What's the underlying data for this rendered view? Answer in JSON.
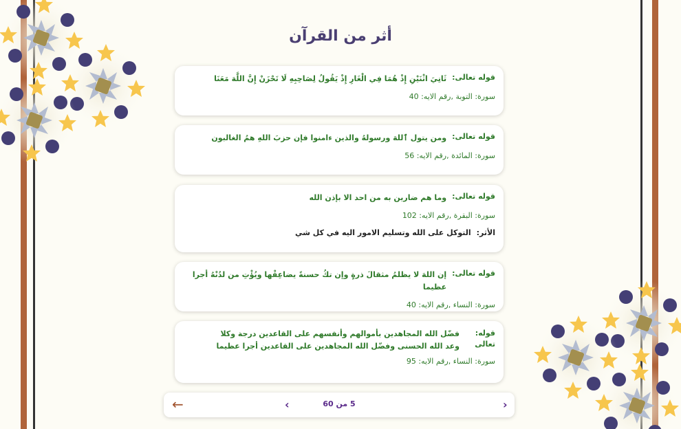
{
  "page": {
    "title": "أثر من القرآن"
  },
  "cards": [
    {
      "label": "قوله تعالى:",
      "verse": "ثَانِيَ اثْنَيْنِ إِذْ هُمَا فِي الْغَارِ إِذْ يَقُولُ لِصَاحِبِهِ لَا تَحْزَنْ إِنَّ اللَّهَ مَعَنَا",
      "reference": "سورة: التوبة ,رقم الايه: 40"
    },
    {
      "label": "قوله تعالى:",
      "verse": "ومن يتول ٱللهَ ورسولهُ والذين ءامنوا فإن حزبَ اللهِ همُ الغالبون",
      "reference": "سورة: المائدة ,رقم الايه: 56"
    },
    {
      "label": "قوله تعالى:",
      "verse": "وما هم ضارين به من احد الا بإذن الله",
      "reference": "سورة: البقرة ,رقم الايه: 102",
      "effect_label": "الأثر:",
      "effect": "التوكل على الله وتسليم الامور اليه في كل شي"
    },
    {
      "label": "قوله تعالى:",
      "verse": "إن اللهَ لا يظلمُ مثقالَ ذرةٍ وإن تكُ حسنةً يضاعِفْها ويُؤْتِ من لدُنْهُ أجرا عظيما",
      "reference": "سورة: النساء ,رقم الايه: 40"
    },
    {
      "label": "قوله: تعالى",
      "verse": "فضّل الله المجاهدين بأموالهم وأنفسهم على القاعدين درجة وكلا وعد الله الحسنى وفضّل الله المجاهدين على القاعدين أجرا عظيما",
      "reference": "سورة: النساء ,رقم الايه: 95"
    }
  ],
  "pager": {
    "count": "5 من 60",
    "prev_icon": "chevron-left-icon",
    "next_icon": "chevron-right-icon",
    "back_icon": "arrow-left-icon"
  },
  "colors": {
    "title": "#4a3f72",
    "verse_green": "#2f7a2a",
    "stripe_brown": "#b0643a",
    "star_gold": "#f7c64d",
    "dot_navy": "#443f75",
    "petal_grey": "#b3bcd0",
    "center_olive": "#a38f4f"
  }
}
